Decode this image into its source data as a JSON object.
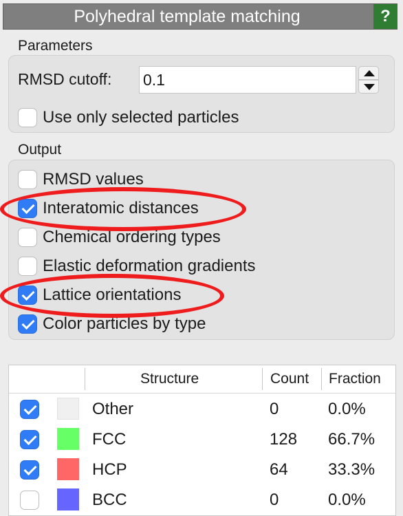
{
  "window": {
    "title": "Polyhedral template matching",
    "help_label": "?"
  },
  "parameters": {
    "section_label": "Parameters",
    "rmsd_label": "RMSD cutoff:",
    "rmsd_value": "0.1",
    "use_selected_label": "Use only selected particles",
    "use_selected_checked": false
  },
  "output": {
    "section_label": "Output",
    "options": [
      {
        "label": "RMSD values",
        "checked": false
      },
      {
        "label": "Interatomic distances",
        "checked": true
      },
      {
        "label": "Chemical ordering types",
        "checked": false
      },
      {
        "label": "Elastic deformation gradients",
        "checked": false
      },
      {
        "label": "Lattice orientations",
        "checked": true
      },
      {
        "label": "Color particles by type",
        "checked": true
      }
    ]
  },
  "structure_table": {
    "headers": {
      "structure": "Structure",
      "count": "Count",
      "fraction": "Fraction"
    },
    "rows": [
      {
        "enabled": true,
        "color": "#f0f0f0",
        "name": "Other",
        "count": "0",
        "fraction": "0.0%"
      },
      {
        "enabled": true,
        "color": "#66ff66",
        "name": "FCC",
        "count": "128",
        "fraction": "66.7%"
      },
      {
        "enabled": true,
        "color": "#ff6666",
        "name": "HCP",
        "count": "64",
        "fraction": "33.3%"
      },
      {
        "enabled": false,
        "color": "#6666ff",
        "name": "BCC",
        "count": "0",
        "fraction": "0.0%"
      }
    ]
  },
  "colors": {
    "highlight": "#ee1c1c",
    "accent": "#2f7cf6",
    "title_bar": "#7f7f7f",
    "help_button": "#2f7d32"
  },
  "icons": {
    "spin_up": "triangle-up",
    "spin_down": "triangle-down",
    "check": "checkmark"
  }
}
